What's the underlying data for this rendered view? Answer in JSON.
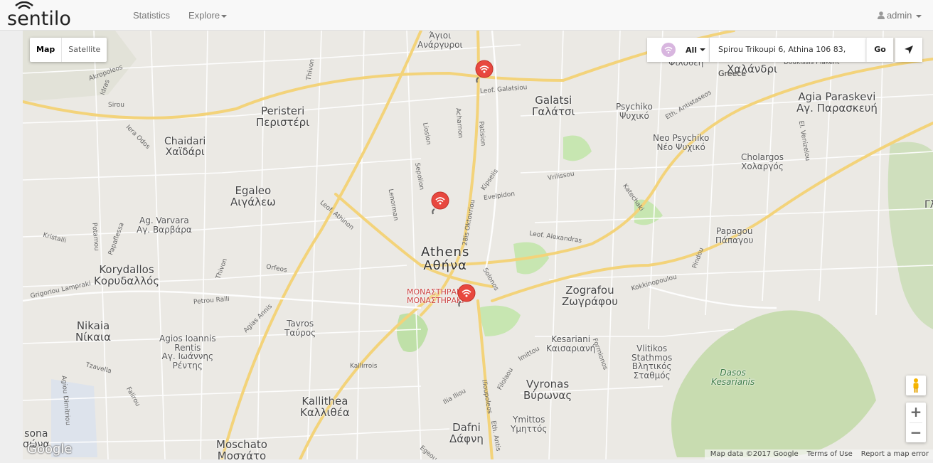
{
  "brand": {
    "logo_text": "sentilo"
  },
  "nav": {
    "statistics": "Statistics",
    "explore": "Explore",
    "user": "admin"
  },
  "map": {
    "type_controls": {
      "map": "Map",
      "satellite": "Satellite",
      "active": "Map"
    },
    "filter": {
      "selected": "All",
      "icon": "wifi-icon"
    },
    "address": "Spirou Trikoupi 6, Athina 106 83, Greece",
    "go_label": "Go",
    "zoom_in": "+",
    "zoom_out": "−",
    "attribution": {
      "data": "Map data ©2017 Google",
      "terms": "Terms of Use",
      "report": "Report a map error"
    },
    "google_logo": "Google",
    "places": {
      "agioi_anargyroi": "Άγιοι\nΑνάργυροι",
      "filothei": "Φιλοθέη",
      "chalandri": "Χαλάνδρι",
      "peristeri": "Peristeri\nΠεριστέρι",
      "galatsi": "Galatsi\nΓαλάτσι",
      "psychiko": "Psychiko\nΨυχικό",
      "agia_paraskevi": "Agia Paraskevi\nΑγ. Παρασκευή",
      "chaidari": "Chaidari\nΧαϊδάρι",
      "neo_psychiko": "Neo Psychiko\nΝέο Ψυχικό",
      "cholargos": "Cholargos\nΧολαργός",
      "egaleo": "Egaleo\nΑιγάλεω",
      "ag_varvara": "Ag. Varvara\nΑγ. Βαρβάρα",
      "papagou": "Papagou\nΠάπαγου",
      "athens": "Athens\nΑθήνα",
      "korydallos": "Korydallos\nΚορυδαλλός",
      "monastiraki": "ΜΟΝΑΣΤΗΡΑΚΙ\nΜΟΝΑΣΤΗΡΑΚΙ",
      "zografou": "Zografou\nΖωγράφου",
      "nikaia": "Nikaia\nΝίκαια",
      "tavros": "Tavros\nΤαύρος",
      "agios_ioannis": "Agios Ioannis\nRentis\nΑγ. Ιωάννης\nΡέντης",
      "kesariani": "Kesariani\nΚαισαριανή",
      "vlitikos": "Vlitikos\nStathmos\nΒλητικός\nΣταθμός",
      "dasos": "Dasos\nKesarianis",
      "vyronas": "Vyronas\nΒύρωνας",
      "kallithea": "Kallithea\nΚαλλιθέα",
      "ymittos": "Ymittos\nΥμηττός",
      "dafni": "Dafni\nΔάφνη",
      "moschato": "Moschato\nΜοσχάτο",
      "sona": "sona\nσώνα",
      "g_edge": "Γλ"
    },
    "streets": {
      "galatsiou": "Leof. Galatsiou",
      "athinon": "Leof. Athinon",
      "alexandras": "Leof. Alexandras",
      "katechaki": "Katechaki",
      "vrilissou": "Vrilissou",
      "kipselis": "Kipselis",
      "evelpidon": "Evelpidon",
      "oktovriou": "28is Oktovriou",
      "lenorman": "Lenorman",
      "sepolion": "Sepolion",
      "liosion": "Liosion",
      "acharnon": "Acharnon",
      "patision": "Patision",
      "thivon": "Thivon",
      "iera_odos": "Iera Odos",
      "sirou": "Sirou",
      "akropoleos": "Akropoleos",
      "idras": "Idras",
      "kristalli": "Kristalli",
      "potamou": "Potamou",
      "papaflessa": "Papaflessa",
      "lampraki": "Grigoriou Lampraki",
      "petrou_ralli": "Petrou Ralli",
      "orfeos": "Orfeos",
      "agias_annis": "Agias Annis",
      "solonos": "Solonos",
      "kokkinopoulou": "Kokkinopoulou",
      "pindou": "Pindou",
      "imittou": "Imittou",
      "formionos": "Formionos",
      "kallirrois": "Kallirrois",
      "ilia_iliou": "Ilia Iliou",
      "filolaou": "Filolaou",
      "ilioupoleos": "Ilioupoleos",
      "eth_antistaseos": "Eth. Antistaseos",
      "el_venizelou": "El. Venizelou",
      "doukissis": "Doukissis Plakent",
      "agiou_dimitriou": "Agiou Dimitriou",
      "tzaverla": "Tzavella",
      "falirou": "Falirou",
      "egeou": "Egeou",
      "eth_antis": "Eth. Antis"
    },
    "markers": [
      {
        "name": "sensor-marker-1",
        "icon": "wifi-icon"
      },
      {
        "name": "sensor-marker-2",
        "icon": "wifi-icon"
      },
      {
        "name": "sensor-marker-3",
        "icon": "wifi-icon"
      }
    ]
  }
}
